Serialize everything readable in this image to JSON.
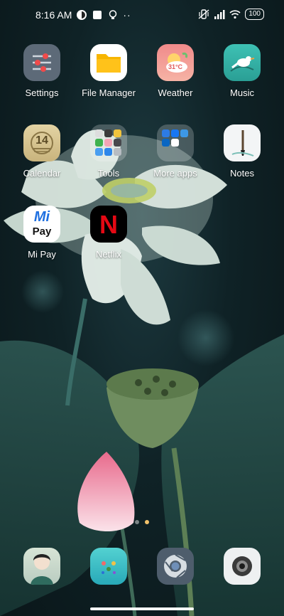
{
  "status_bar": {
    "time": "8:16 AM",
    "battery": "100"
  },
  "apps": {
    "settings": "Settings",
    "file_manager": "File Manager",
    "weather": "Weather",
    "weather_temp": "31°C",
    "music": "Music",
    "calendar": "Calendar",
    "calendar_day": "14",
    "tools": "Tools",
    "more_apps": "More apps",
    "notes": "Notes",
    "mi_pay": "Mi Pay",
    "mi_pay_logo_top": "Mi",
    "mi_pay_logo_bottom": "Pay",
    "netflix": "Netflix",
    "netflix_logo": "N"
  },
  "page_indicator": {
    "pages": 2,
    "current": 2
  },
  "colors": {
    "accent_dot": "#f2c26b",
    "netflix_red": "#e50914"
  }
}
